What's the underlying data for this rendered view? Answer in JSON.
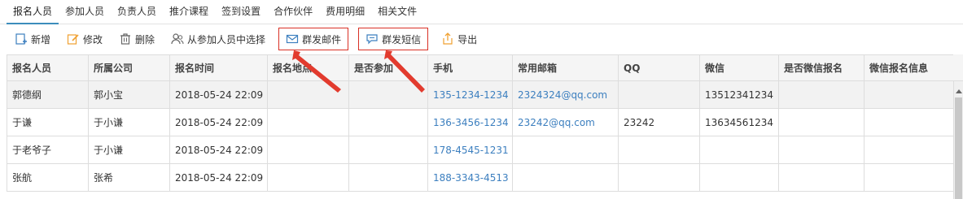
{
  "tabs": [
    "报名人员",
    "参加人员",
    "负责人员",
    "推介课程",
    "签到设置",
    "合作伙伴",
    "费用明细",
    "相关文件"
  ],
  "toolbar": {
    "add": "新增",
    "edit": "修改",
    "delete": "删除",
    "select_from_participants": "从参加人员中选择",
    "mass_email": "群发邮件",
    "mass_sms": "群发短信",
    "export": "导出"
  },
  "table": {
    "headers": [
      "报名人员",
      "所属公司",
      "报名时间",
      "报名地点",
      "是否参加",
      "手机",
      "常用邮箱",
      "QQ",
      "微信",
      "是否微信报名",
      "微信报名信息"
    ],
    "rows": [
      [
        "郭德纲",
        "郭小宝",
        "2018-05-24 22:09",
        "",
        "",
        "135-1234-1234",
        "2324324@qq.com",
        "",
        "13512341234",
        "",
        ""
      ],
      [
        "于谦",
        "于小谦",
        "2018-05-24 22:09",
        "",
        "",
        "136-3456-1234",
        "23242@qq.com",
        "23242",
        "13634561234",
        "",
        ""
      ],
      [
        "于老爷子",
        "于小谦",
        "2018-05-24 22:09",
        "",
        "",
        "178-4545-1231",
        "",
        "",
        "",
        "",
        ""
      ],
      [
        "张航",
        "张希",
        "2018-05-24 22:09",
        "",
        "",
        "188-3343-4513",
        "",
        "",
        "",
        "",
        ""
      ]
    ]
  },
  "colors": {
    "accent": "#3c8dbc",
    "link": "#3c7fbf",
    "highlight": "#d93025"
  }
}
